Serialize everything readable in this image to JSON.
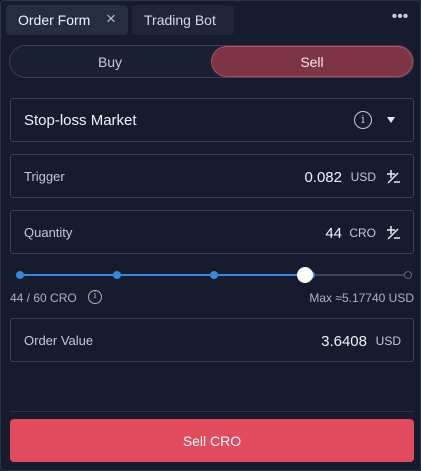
{
  "tabs": [
    {
      "label": "Order Form",
      "active": true
    },
    {
      "label": "Trading Bot",
      "active": false
    }
  ],
  "side_toggle": {
    "buy_label": "Buy",
    "sell_label": "Sell",
    "selected": "Sell"
  },
  "order_type": {
    "selected": "Stop-loss Market"
  },
  "trigger": {
    "label": "Trigger",
    "value": "0.082",
    "unit": "USD"
  },
  "quantity": {
    "label": "Quantity",
    "value": "44",
    "unit": "CRO"
  },
  "slider": {
    "fraction": 0.7333,
    "left_text": "44 / 60 CRO",
    "right_text": "Max ≈5.17740 USD"
  },
  "order_value": {
    "label": "Order Value",
    "value": "3.6408",
    "unit": "USD"
  },
  "submit": {
    "label": "Sell CRO"
  },
  "colors": {
    "accent_sell": "#e24a5d",
    "slider_blue": "#2f8be6",
    "background": "#161c2e"
  },
  "icons": [
    "close-icon",
    "more-icon",
    "info-icon",
    "chevron-down-icon",
    "stepper-icon"
  ]
}
